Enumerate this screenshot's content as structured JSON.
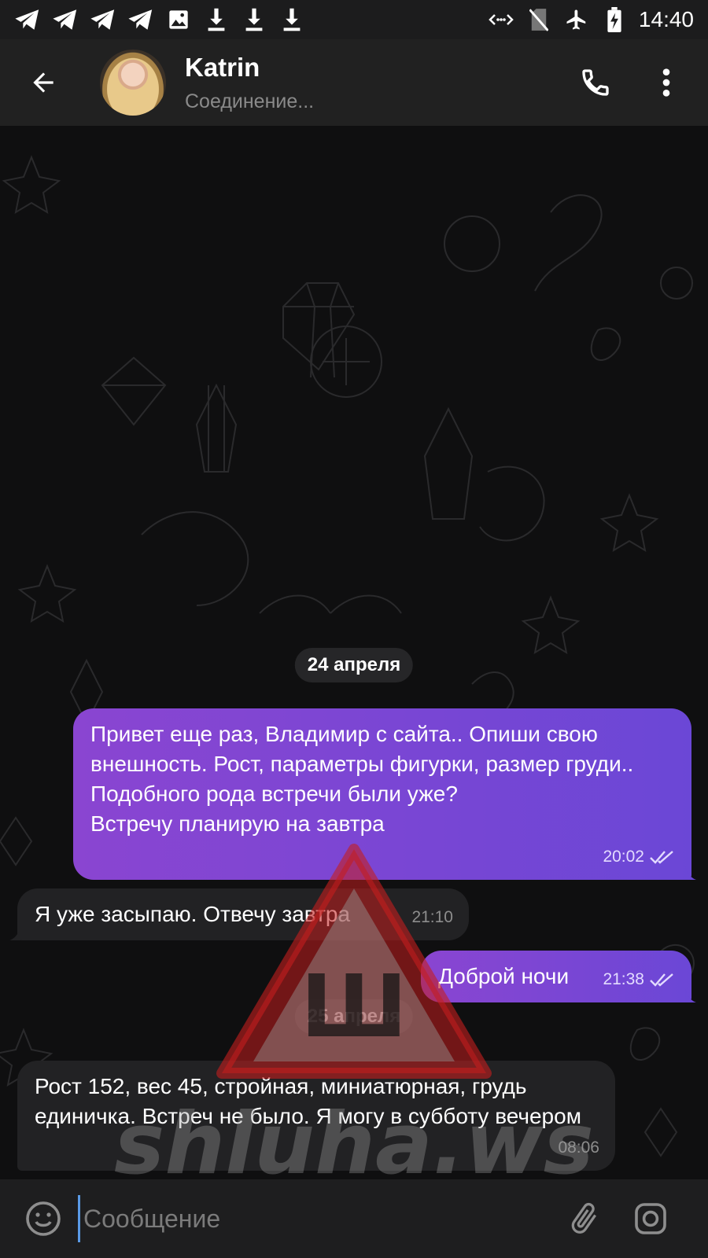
{
  "status_bar": {
    "time": "14:40",
    "notification_icons": [
      "telegram-icon",
      "telegram-icon",
      "telegram-icon",
      "telegram-icon",
      "image-icon",
      "download-icon",
      "download-icon",
      "download-icon"
    ],
    "system_icons": [
      "data-saver-icon",
      "no-sim-icon",
      "airplane-icon",
      "battery-charging-icon"
    ]
  },
  "header": {
    "title": "Katrin",
    "status": "Соединение...",
    "icons": {
      "back": "arrow-left-icon",
      "call": "phone-icon",
      "menu": "more-vert-icon"
    }
  },
  "messages": [
    {
      "type": "date",
      "text": "24 апреля"
    },
    {
      "type": "outgoing",
      "text": "Привет еще раз, Владимир с сайта.. Опиши свою внешность. Рост, параметры фигурки, размер груди..\nПодобного рода встречи были уже?\nВстречу планирую на завтра",
      "time": "20:02",
      "status": "read"
    },
    {
      "type": "incoming",
      "text": "Я уже засыпаю. Отвечу завтра",
      "time": "21:10"
    },
    {
      "type": "outgoing",
      "text": "Доброй ночи",
      "time": "21:38",
      "status": "read"
    },
    {
      "type": "date",
      "text": "25 апреля"
    },
    {
      "type": "incoming",
      "text": "Рост 152, вес 45, стройная, миниатюрная, грудь единичка. Встреч не было. Я могу в субботу вечером",
      "time": "08:06"
    }
  ],
  "watermark": {
    "logo_text": "Ш",
    "text": "shluha.ws"
  },
  "input": {
    "placeholder": "Сообщение",
    "icons": {
      "emoji": "smile-icon",
      "attach": "paperclip-icon",
      "camera": "camera-icon"
    }
  },
  "colors": {
    "outgoing_bubble": "#7b46d4",
    "incoming_bubble": "#222224",
    "background": "#0f0f10",
    "header": "#212121"
  }
}
